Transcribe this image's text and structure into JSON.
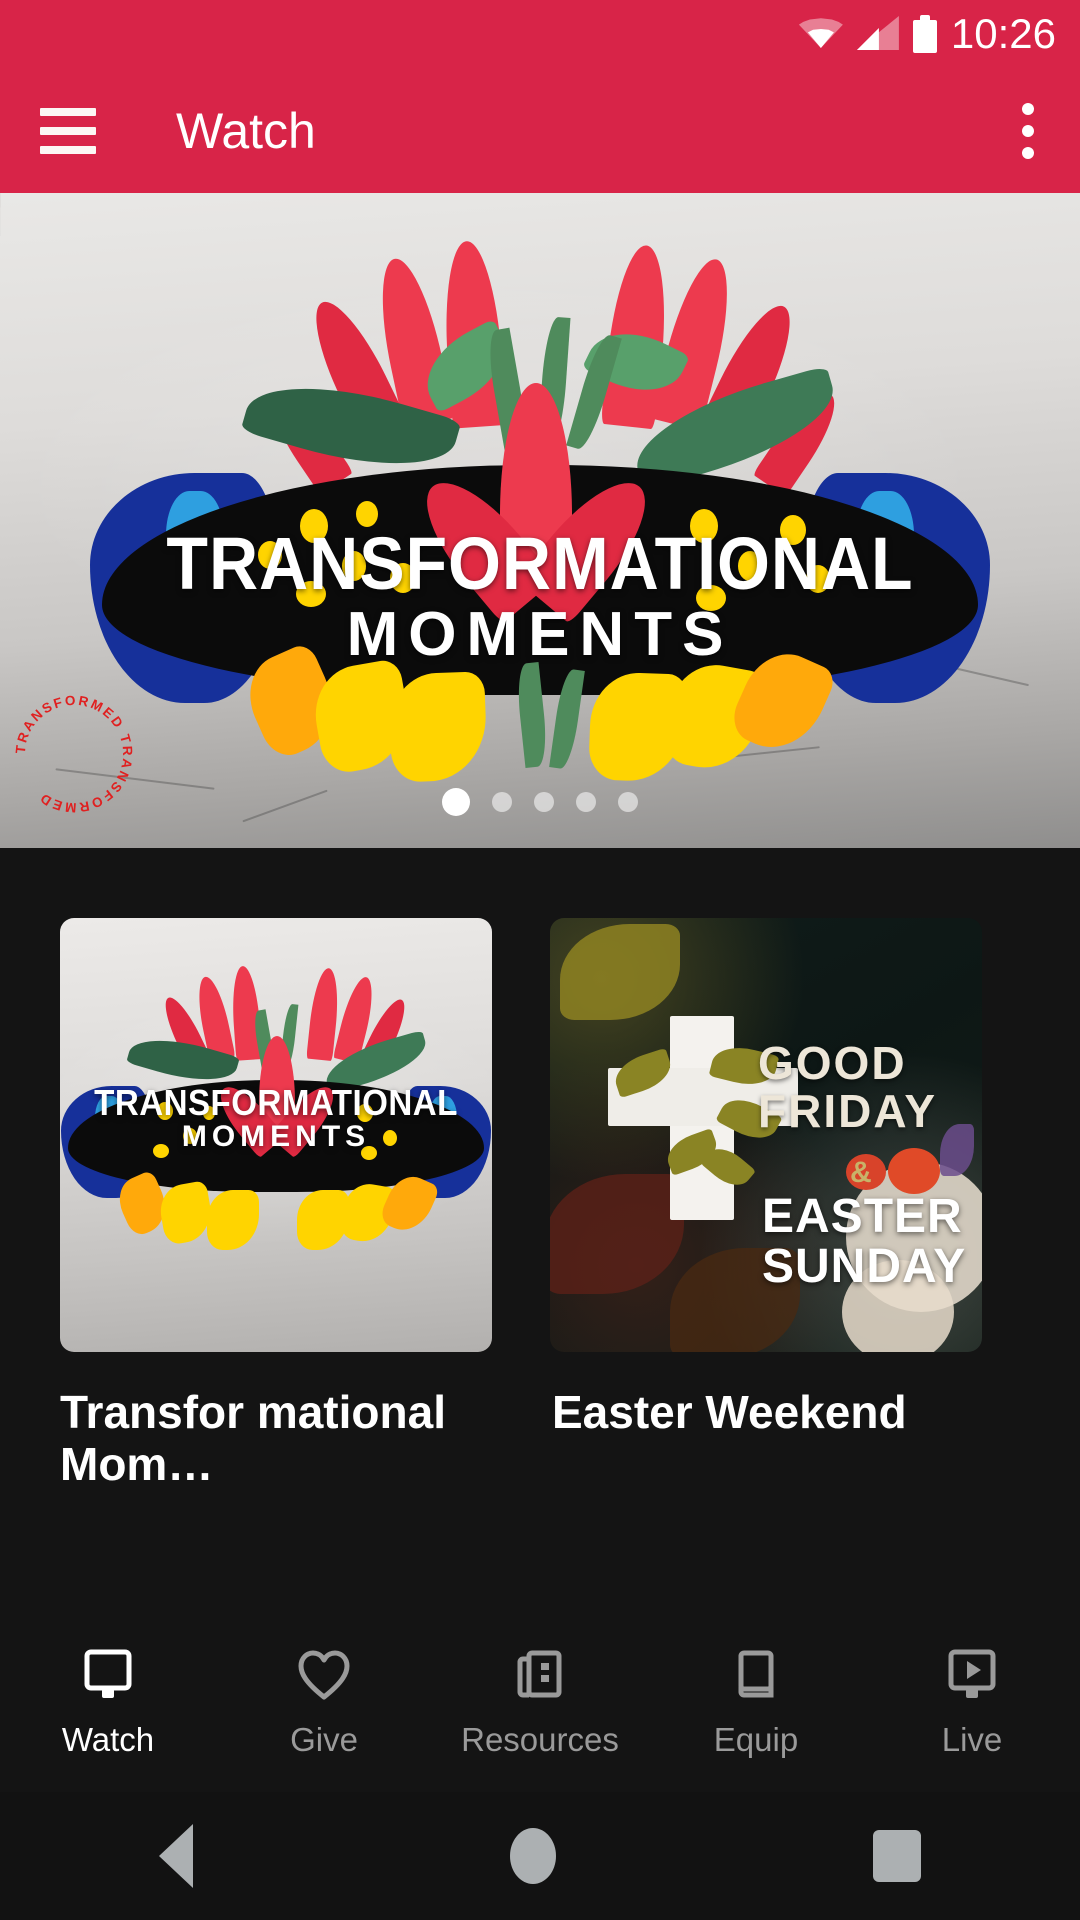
{
  "statusbar": {
    "time": "10:26",
    "icons": [
      "wifi-icon",
      "cellular-signal-icon",
      "battery-icon"
    ]
  },
  "appbar": {
    "menu_icon": "hamburger-menu-icon",
    "title": "Watch",
    "overflow_icon": "more-vertical-icon",
    "accent_color": "#D82448"
  },
  "hero": {
    "title_line1": "TRANSFORMATIONAL",
    "title_line2": "MOMENTS",
    "stamp_text": "TRANSFORMED TRANSFORMED ",
    "stamp_color": "#E02020",
    "pagination": {
      "total": 5,
      "active_index": 0
    }
  },
  "content": {
    "cards": [
      {
        "title": "Transfor mational Mom…",
        "art_line1": "TRANSFORMATIONAL",
        "art_line2": "MOMENTS"
      },
      {
        "title": "Easter Weekend",
        "art_line1": "GOOD FRIDAY",
        "art_amp": "&",
        "art_line2": "EASTER SUNDAY"
      }
    ]
  },
  "tabbar": {
    "active_index": 0,
    "items": [
      {
        "label": "Watch",
        "icon": "monitor-icon"
      },
      {
        "label": "Give",
        "icon": "heart-icon"
      },
      {
        "label": "Resources",
        "icon": "newspaper-icon"
      },
      {
        "label": "Equip",
        "icon": "book-icon"
      },
      {
        "label": "Live",
        "icon": "monitor-play-icon"
      }
    ]
  },
  "system_nav": {
    "back": "back-triangle-icon",
    "home": "home-circle-icon",
    "recents": "recents-square-icon"
  },
  "colors": {
    "brand_red": "#D82448",
    "background_dark": "#141414",
    "text_primary": "#FFFFFF",
    "text_muted": "#9A9A9A"
  }
}
